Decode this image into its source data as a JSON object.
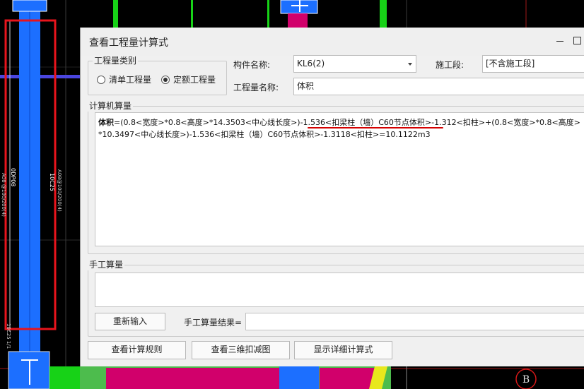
{
  "cad": {
    "labels": [
      "0DP08",
      "10C25",
      "A08 @100/200(4)",
      "A08@100/200(4)",
      "18C25 1/1"
    ],
    "axis_label": "B"
  },
  "dialog": {
    "title": "查看工程量计算式",
    "quantity_type": {
      "title": "工程量类别",
      "options": [
        "清单工程量",
        "定额工程量"
      ],
      "selected": "定额工程量"
    },
    "component_name": {
      "label": "构件名称:",
      "value": "KL6(2)"
    },
    "construction_section": {
      "label": "施工段:",
      "value": "[不含施工段]"
    },
    "quantity_name": {
      "label": "工程量名称:",
      "value": "体积"
    },
    "computer_calc": {
      "title": "计算机算量",
      "line1_prefix": "体积",
      "line1_rest": "=(0.8<宽度>*0.8<高度>*14.3503<中心线长度>)-1.536<扣梁柱（墙）C60节点体积>-1.312<扣柱>+(0.8<宽度>*0.8<高度>",
      "line2": "*10.3497<中心线长度>)-1.536<扣梁柱（墙）C60节点体积>-1.3118<扣柱>=10.1122m3"
    },
    "manual_calc": {
      "title": "手工算量",
      "reenter_button": "重新输入",
      "result_label": "手工算量结果=",
      "result_value": ""
    },
    "buttons": {
      "view_rules": "查看计算规则",
      "view_3d": "查看三维扣减图",
      "show_detail": "显示详细计算式"
    }
  }
}
